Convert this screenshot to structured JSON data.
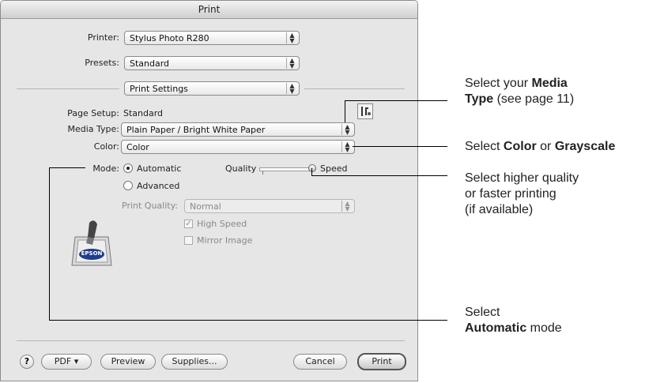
{
  "dialog": {
    "title": "Print",
    "printer_label": "Printer:",
    "printer_value": "Stylus Photo R280",
    "presets_label": "Presets:",
    "presets_value": "Standard",
    "section_value": "Print Settings",
    "page_setup_label": "Page Setup:",
    "page_setup_value": "Standard",
    "media_type_label": "Media Type:",
    "media_type_value": "Plain Paper / Bright White Paper",
    "color_label": "Color:",
    "color_value": "Color",
    "mode_label": "Mode:",
    "mode_automatic": "Automatic",
    "mode_advanced": "Advanced",
    "quality_label": "Quality",
    "speed_label": "Speed",
    "print_quality_label": "Print Quality:",
    "print_quality_value": "Normal",
    "high_speed_label": "High Speed",
    "mirror_image_label": "Mirror Image",
    "help_label": "?",
    "pdf_label": "PDF ▾",
    "preview_label": "Preview",
    "supplies_label": "Supplies...",
    "cancel_label": "Cancel",
    "print_label": "Print",
    "logo_text": "EPSON"
  },
  "callouts": {
    "media_1": "Select your ",
    "media_b1": "Media",
    "media_b2": "Type",
    "media_2": " (see page 11)",
    "color_1": "Select ",
    "color_b1": "Color",
    "color_2": " or ",
    "color_b2": "Grayscale",
    "quality_l1": "Select higher quality",
    "quality_l2": "or faster printing",
    "quality_l3": "(if available)",
    "mode_l1": "Select",
    "mode_b": "Automatic",
    "mode_2": " mode"
  },
  "state": {
    "mode_selected": "Automatic",
    "high_speed_checked": true,
    "mirror_image_checked": false,
    "quality_speed_slider": 1.0
  },
  "colors": {
    "dialog_bg": "#e6e6e6",
    "callout_line": "#000000"
  },
  "icons": [
    "up-down-arrows-icon",
    "utility-tools-icon",
    "epson-printer-icon",
    "help-icon"
  ]
}
